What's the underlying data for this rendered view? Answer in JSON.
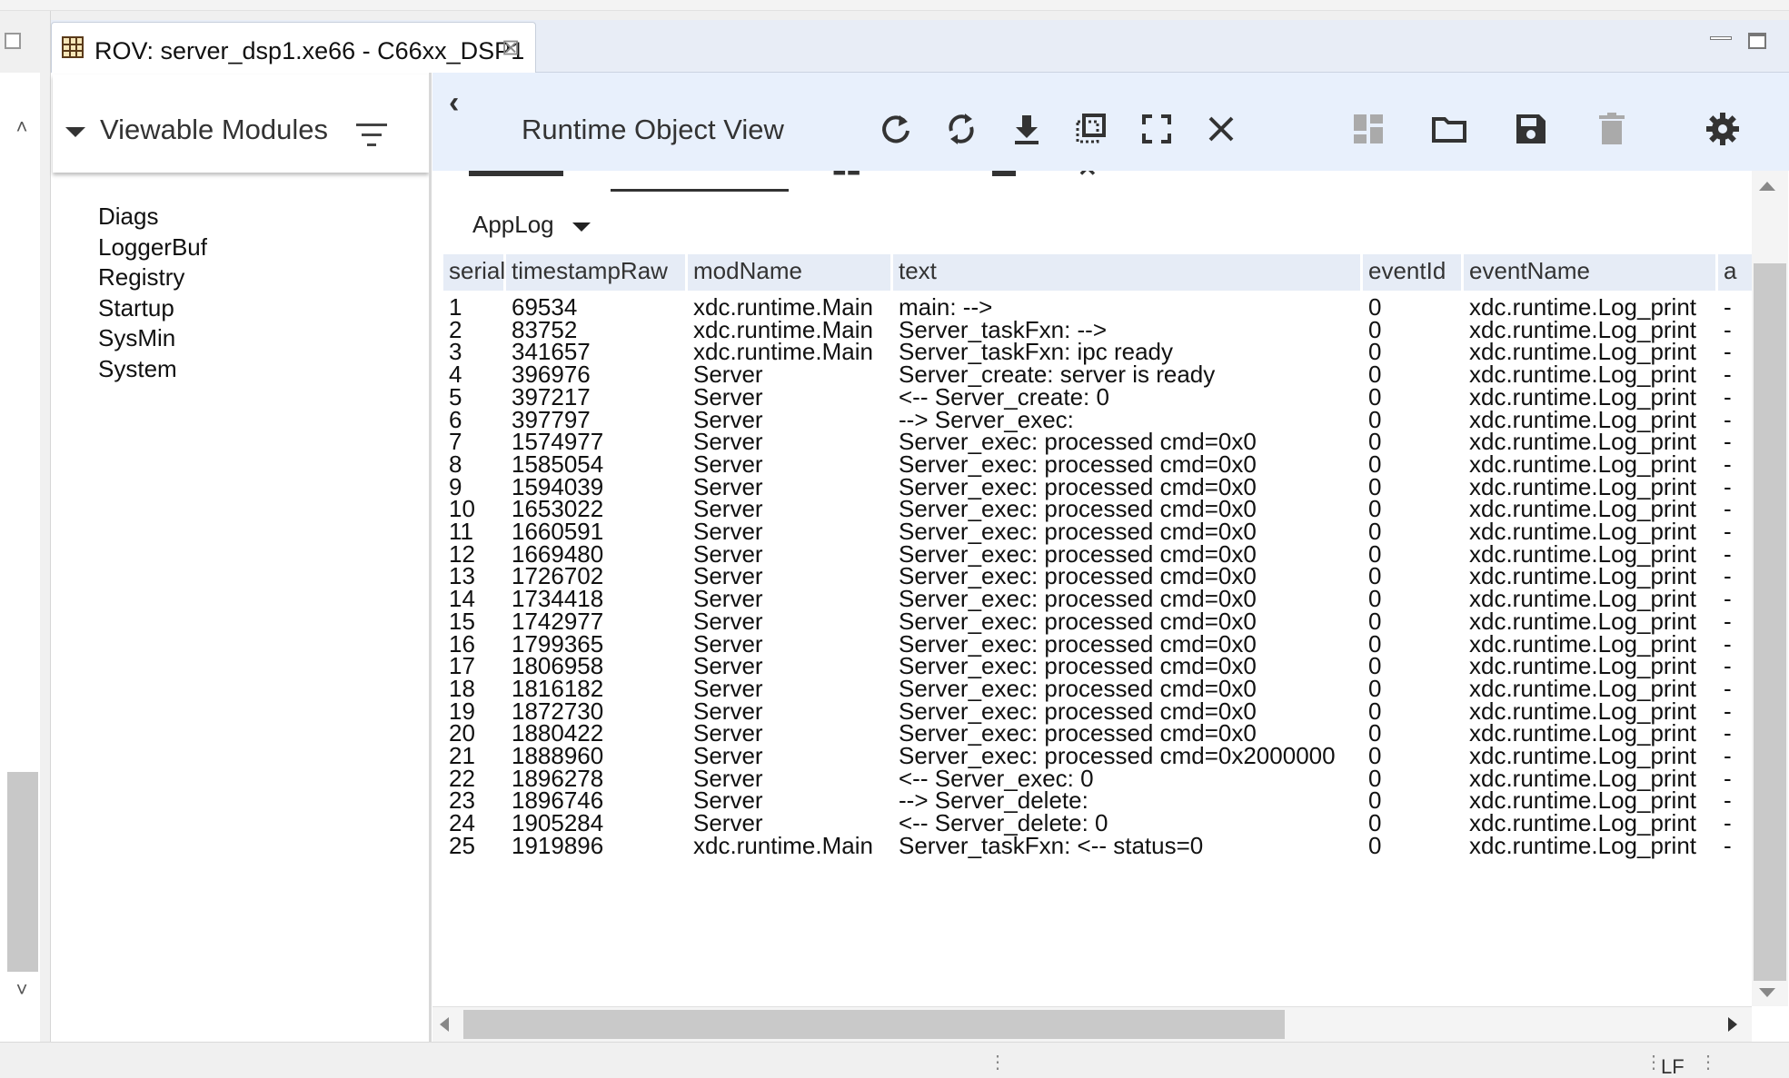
{
  "window": {
    "tab_title": "ROV: server_dsp1.xe66 - C66xx_DSP1",
    "tab_close_glyph": "⊠"
  },
  "sidebar": {
    "title": "Viewable Modules",
    "modules": [
      "Diags",
      "LoggerBuf",
      "Registry",
      "Startup",
      "SysMin",
      "System"
    ]
  },
  "rov": {
    "title": "Runtime Object View",
    "toolbar_icons": [
      "refresh-icon",
      "auto-refresh-icon",
      "download-icon",
      "clone-view-icon",
      "fullscreen-icon",
      "close-icon"
    ],
    "right_icons": [
      "dashboard-icon",
      "open-folder-icon",
      "save-icon",
      "delete-icon",
      "settings-icon"
    ],
    "selected_logger": "AppLog"
  },
  "table": {
    "columns": [
      "serial",
      "timestampRaw",
      "modName",
      "text",
      "eventId",
      "eventName",
      "a"
    ],
    "rows": [
      [
        "1",
        "69534",
        "xdc.runtime.Main",
        "main: -->",
        "0",
        "xdc.runtime.Log_print",
        "-"
      ],
      [
        "2",
        "83752",
        "xdc.runtime.Main",
        "Server_taskFxn: -->",
        "0",
        "xdc.runtime.Log_print",
        "-"
      ],
      [
        "3",
        "341657",
        "xdc.runtime.Main",
        "Server_taskFxn: ipc ready",
        "0",
        "xdc.runtime.Log_print",
        "-"
      ],
      [
        "4",
        "396976",
        "Server",
        "Server_create: server is ready",
        "0",
        "xdc.runtime.Log_print",
        "-"
      ],
      [
        "5",
        "397217",
        "Server",
        "<-- Server_create: 0",
        "0",
        "xdc.runtime.Log_print",
        "-"
      ],
      [
        "6",
        "397797",
        "Server",
        "--> Server_exec:",
        "0",
        "xdc.runtime.Log_print",
        "-"
      ],
      [
        "7",
        "1574977",
        "Server",
        "Server_exec: processed cmd=0x0",
        "0",
        "xdc.runtime.Log_print",
        "-"
      ],
      [
        "8",
        "1585054",
        "Server",
        "Server_exec: processed cmd=0x0",
        "0",
        "xdc.runtime.Log_print",
        "-"
      ],
      [
        "9",
        "1594039",
        "Server",
        "Server_exec: processed cmd=0x0",
        "0",
        "xdc.runtime.Log_print",
        "-"
      ],
      [
        "10",
        "1653022",
        "Server",
        "Server_exec: processed cmd=0x0",
        "0",
        "xdc.runtime.Log_print",
        "-"
      ],
      [
        "11",
        "1660591",
        "Server",
        "Server_exec: processed cmd=0x0",
        "0",
        "xdc.runtime.Log_print",
        "-"
      ],
      [
        "12",
        "1669480",
        "Server",
        "Server_exec: processed cmd=0x0",
        "0",
        "xdc.runtime.Log_print",
        "-"
      ],
      [
        "13",
        "1726702",
        "Server",
        "Server_exec: processed cmd=0x0",
        "0",
        "xdc.runtime.Log_print",
        "-"
      ],
      [
        "14",
        "1734418",
        "Server",
        "Server_exec: processed cmd=0x0",
        "0",
        "xdc.runtime.Log_print",
        "-"
      ],
      [
        "15",
        "1742977",
        "Server",
        "Server_exec: processed cmd=0x0",
        "0",
        "xdc.runtime.Log_print",
        "-"
      ],
      [
        "16",
        "1799365",
        "Server",
        "Server_exec: processed cmd=0x0",
        "0",
        "xdc.runtime.Log_print",
        "-"
      ],
      [
        "17",
        "1806958",
        "Server",
        "Server_exec: processed cmd=0x0",
        "0",
        "xdc.runtime.Log_print",
        "-"
      ],
      [
        "18",
        "1816182",
        "Server",
        "Server_exec: processed cmd=0x0",
        "0",
        "xdc.runtime.Log_print",
        "-"
      ],
      [
        "19",
        "1872730",
        "Server",
        "Server_exec: processed cmd=0x0",
        "0",
        "xdc.runtime.Log_print",
        "-"
      ],
      [
        "20",
        "1880422",
        "Server",
        "Server_exec: processed cmd=0x0",
        "0",
        "xdc.runtime.Log_print",
        "-"
      ],
      [
        "21",
        "1888960",
        "Server",
        "Server_exec: processed cmd=0x2000000",
        "0",
        "xdc.runtime.Log_print",
        "-"
      ],
      [
        "22",
        "1896278",
        "Server",
        "<-- Server_exec: 0",
        "0",
        "xdc.runtime.Log_print",
        "-"
      ],
      [
        "23",
        "1896746",
        "Server",
        "--> Server_delete:",
        "0",
        "xdc.runtime.Log_print",
        "-"
      ],
      [
        "24",
        "1905284",
        "Server",
        "<-- Server_delete: 0",
        "0",
        "xdc.runtime.Log_print",
        "-"
      ],
      [
        "25",
        "1919896",
        "xdc.runtime.Main",
        "Server_taskFxn: <-- status=0",
        "0",
        "xdc.runtime.Log_print",
        "-"
      ]
    ]
  },
  "statusbar": {
    "line_ending": "LF"
  },
  "colors": {
    "toolbar_bg": "#e8f0fc",
    "header_bg": "#e6ecf6",
    "scrollbar_thumb": "#c9c9c9"
  }
}
